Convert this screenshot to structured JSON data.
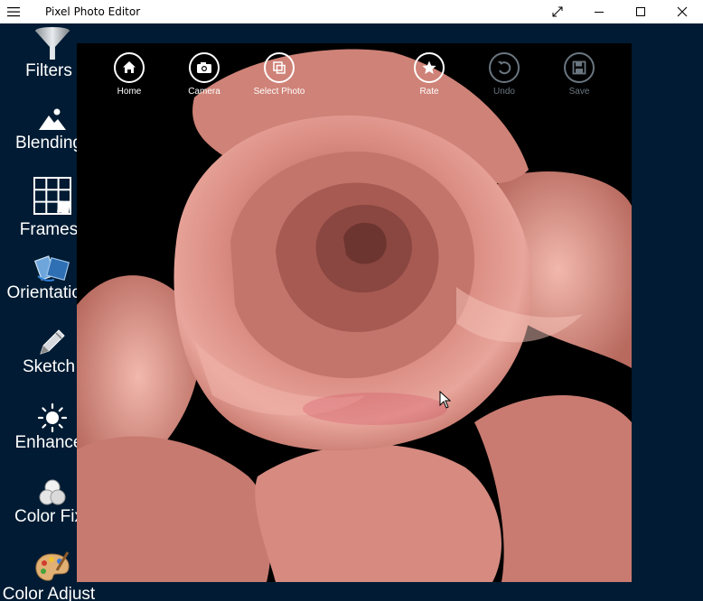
{
  "window": {
    "title": "Pixel Photo Editor",
    "controls": [
      "fullscreen-icon",
      "minimize-icon",
      "maximize-icon",
      "close-icon"
    ]
  },
  "sidebar": {
    "items": [
      {
        "label": "Filters",
        "icon": "funnel-icon"
      },
      {
        "label": "Blending",
        "icon": "mountain-icon"
      },
      {
        "label": "Frames",
        "icon": "grid-icon"
      },
      {
        "label": "Orientation",
        "icon": "rotate-icon"
      },
      {
        "label": "Sketch",
        "icon": "pencil-icon"
      },
      {
        "label": "Enhance",
        "icon": "sun-icon"
      },
      {
        "label": "Color Fix",
        "icon": "circles-icon"
      },
      {
        "label": "Color Adjust",
        "icon": "palette-icon"
      }
    ]
  },
  "toolbar": {
    "items": [
      {
        "label": "Home",
        "icon": "home-icon",
        "enabled": true
      },
      {
        "label": "Camera",
        "icon": "camera-icon",
        "enabled": true
      },
      {
        "label": "Select Photo",
        "icon": "select-photo-icon",
        "enabled": true
      },
      {
        "label": "Rate",
        "icon": "star-icon",
        "enabled": true
      },
      {
        "label": "Undo",
        "icon": "undo-icon",
        "enabled": false
      },
      {
        "label": "Save",
        "icon": "save-icon",
        "enabled": false
      }
    ]
  },
  "colors": {
    "background": "#001b33",
    "photo_tint": "#c9766a",
    "disabled": "#6a7680"
  }
}
